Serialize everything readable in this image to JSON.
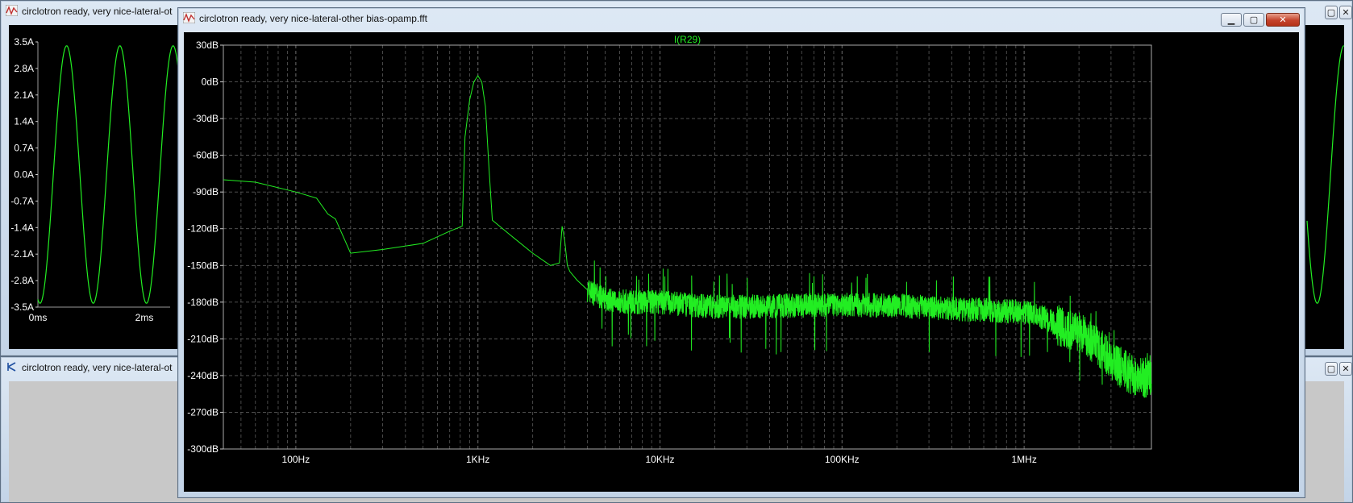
{
  "windows": {
    "back_top": {
      "title": "circlotron ready, very nice-lateral-ot"
    },
    "back_bottom": {
      "title": "circlotron ready, very nice-lateral-ot"
    },
    "main": {
      "title": "circlotron ready, very nice-lateral-other bias-opamp.fft"
    }
  },
  "controls": {
    "minimize": "▁",
    "maximize": "▢",
    "close": "✕"
  },
  "colors": {
    "trace": "#22ee22",
    "grid": "#5a5a5a",
    "plot_bg": "#000000",
    "axis_text": "#ffffff"
  },
  "chart_data": [
    {
      "type": "line",
      "title": "I(R29)",
      "x_scale": "log",
      "x_range": [
        40,
        5000000
      ],
      "ylim": [
        -300,
        30
      ],
      "y_unit": "dB",
      "x_ticks": [
        100,
        1000,
        10000,
        100000,
        1000000
      ],
      "x_tick_labels": [
        "100Hz",
        "1KHz",
        "10KHz",
        "100KHz",
        "1MHz"
      ],
      "y_ticks": [
        30,
        0,
        -30,
        -60,
        -90,
        -120,
        -150,
        -180,
        -210,
        -240,
        -270,
        -300
      ],
      "y_tick_labels": [
        "30dB",
        "0dB",
        "-30dB",
        "-60dB",
        "-90dB",
        "-120dB",
        "-150dB",
        "-180dB",
        "-210dB",
        "-240dB",
        "-270dB",
        "-300dB"
      ],
      "grid": true,
      "series": [
        {
          "name": "I(R29)",
          "x": [
            40,
            60,
            100,
            130,
            150,
            165,
            200,
            300,
            500,
            700,
            820,
            850,
            900,
            950,
            1000,
            1050,
            1100,
            1150,
            1200,
            1500,
            2000,
            2500,
            2800,
            2900,
            3000,
            3100,
            3200,
            3500,
            4000,
            5000,
            7000,
            10000,
            20000,
            50000,
            100000,
            200000,
            500000,
            1000000,
            1300000,
            1600000,
            2000000,
            2500000,
            3000000,
            4000000,
            5000000
          ],
          "y": [
            -80,
            -82,
            -90,
            -95,
            -108,
            -112,
            -140,
            -137,
            -132,
            -122,
            -118,
            -45,
            -15,
            0,
            5,
            0,
            -20,
            -70,
            -113,
            -125,
            -140,
            -150,
            -148,
            -118,
            -130,
            -150,
            -155,
            -162,
            -170,
            -178,
            -180,
            -180,
            -184,
            -183,
            -182,
            -183,
            -186,
            -188,
            -193,
            -200,
            -205,
            -215,
            -228,
            -240,
            -242
          ]
        }
      ]
    },
    {
      "type": "line",
      "title": "",
      "x_tick_labels": [
        "0ms",
        "2ms"
      ],
      "y_ticks": [
        3.5,
        2.8,
        2.1,
        1.4,
        0.7,
        0.0,
        -0.7,
        -1.4,
        -2.1,
        -2.8,
        -3.5
      ],
      "y_tick_labels": [
        "3.5A",
        "2.8A",
        "2.1A",
        "1.4A",
        "0.7A",
        "0.0A",
        "-0.7A",
        "-1.4A",
        "-2.1A",
        "-2.8A",
        "-3.5A"
      ],
      "ylim": [
        -3.5,
        3.5
      ],
      "x_range_ms": [
        0,
        3.7
      ],
      "grid": false,
      "series": [
        {
          "function": "sine",
          "amplitude": 3.4,
          "frequency_khz": 1
        }
      ]
    }
  ]
}
